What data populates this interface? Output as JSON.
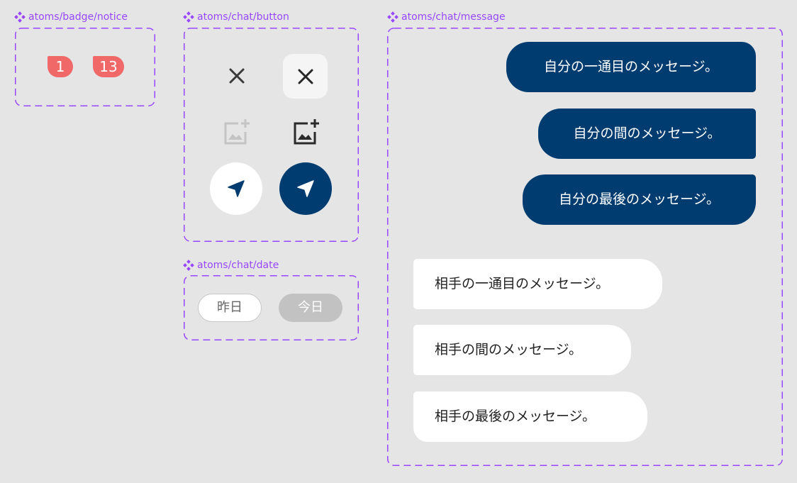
{
  "accent_color": "#9747ff",
  "components": {
    "badge_notice": {
      "label": "atoms/badge/notice",
      "badges": [
        "1",
        "13"
      ],
      "badge_color": "#f06868"
    },
    "chat_button": {
      "label": "atoms/chat/button",
      "icons": [
        "close-icon",
        "close-icon",
        "image-add-icon",
        "image-add-icon",
        "send-icon",
        "send-icon"
      ],
      "navy_color": "#003c70"
    },
    "chat_date": {
      "label": "atoms/chat/date",
      "chips": [
        "昨日",
        "今日"
      ]
    },
    "chat_message": {
      "label": "atoms/chat/message",
      "mine": [
        "自分の一通目のメッセージ。",
        "自分の間のメッセージ。",
        "自分の最後のメッセージ。"
      ],
      "theirs": [
        "相手の一通目のメッセージ。",
        "相手の間のメッセージ。",
        "相手の最後のメッセージ。"
      ]
    }
  }
}
